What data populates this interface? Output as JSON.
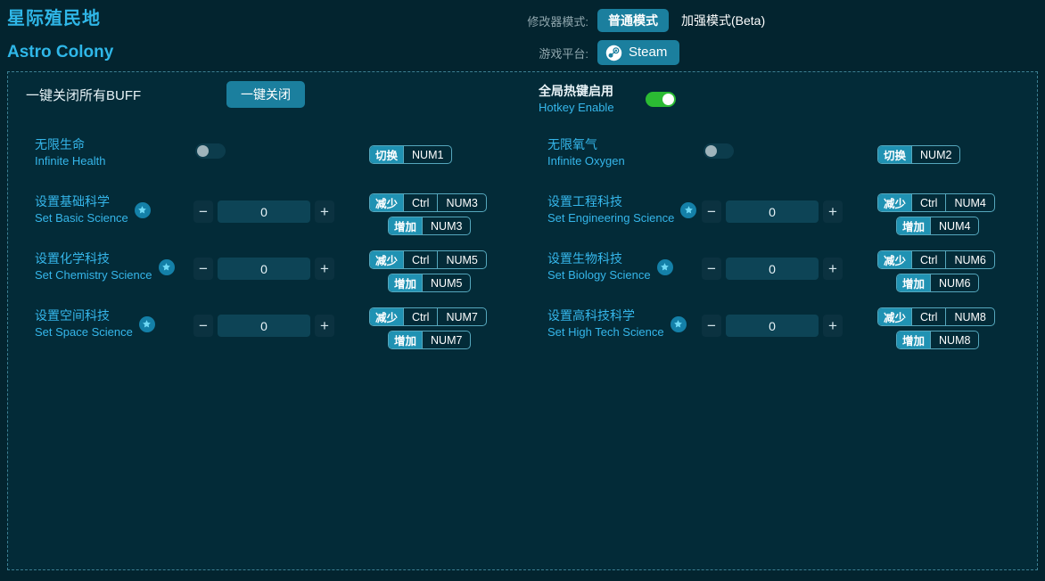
{
  "app": {
    "title_cn": "星际殖民地",
    "title_en": "Astro Colony"
  },
  "header": {
    "mode_label": "修改器模式:",
    "mode_normal": "普通模式",
    "mode_beta": "加强模式(Beta)",
    "platform_label": "游戏平台:",
    "platform_value": "Steam",
    "platform_icon": "steam-icon"
  },
  "toolbar": {
    "close_all_label": "一键关闭所有BUFF",
    "close_all_button": "一键关闭",
    "hotkey_cn": "全局热键启用",
    "hotkey_en": "Hotkey Enable",
    "hotkey_state": "on"
  },
  "left_rows": [
    {
      "cn": "无限生命",
      "en": "Infinite Health",
      "type": "toggle",
      "state": "off",
      "star": false,
      "hotkeys": [
        {
          "tag": "切换",
          "keys": [
            "NUM1"
          ],
          "indent": false
        }
      ]
    },
    {
      "cn": "设置基础科学",
      "en": "Set Basic Science",
      "type": "stepper",
      "value": "0",
      "minus": "−",
      "plus": "+",
      "star": true,
      "hotkeys": [
        {
          "tag": "减少",
          "keys": [
            "Ctrl",
            "NUM3"
          ],
          "indent": false
        },
        {
          "tag": "增加",
          "keys": [
            "NUM3"
          ],
          "indent": true
        }
      ]
    },
    {
      "cn": "设置化学科技",
      "en": "Set Chemistry Science",
      "type": "stepper",
      "value": "0",
      "minus": "−",
      "plus": "+",
      "star": true,
      "hotkeys": [
        {
          "tag": "减少",
          "keys": [
            "Ctrl",
            "NUM5"
          ],
          "indent": false
        },
        {
          "tag": "增加",
          "keys": [
            "NUM5"
          ],
          "indent": true
        }
      ]
    },
    {
      "cn": "设置空间科技",
      "en": "Set Space Science",
      "type": "stepper",
      "value": "0",
      "minus": "−",
      "plus": "+",
      "star": true,
      "hotkeys": [
        {
          "tag": "减少",
          "keys": [
            "Ctrl",
            "NUM7"
          ],
          "indent": false
        },
        {
          "tag": "增加",
          "keys": [
            "NUM7"
          ],
          "indent": true
        }
      ]
    }
  ],
  "right_rows": [
    {
      "cn": "无限氧气",
      "en": "Infinite Oxygen",
      "type": "toggle",
      "state": "off",
      "star": false,
      "hotkeys": [
        {
          "tag": "切换",
          "keys": [
            "NUM2"
          ],
          "indent": false
        }
      ]
    },
    {
      "cn": "设置工程科技",
      "en": "Set Engineering Science",
      "type": "stepper",
      "value": "0",
      "minus": "−",
      "plus": "+",
      "star": true,
      "hotkeys": [
        {
          "tag": "减少",
          "keys": [
            "Ctrl",
            "NUM4"
          ],
          "indent": false
        },
        {
          "tag": "增加",
          "keys": [
            "NUM4"
          ],
          "indent": true
        }
      ]
    },
    {
      "cn": "设置生物科技",
      "en": "Set Biology Science",
      "type": "stepper",
      "value": "0",
      "minus": "−",
      "plus": "+",
      "star": true,
      "hotkeys": [
        {
          "tag": "减少",
          "keys": [
            "Ctrl",
            "NUM6"
          ],
          "indent": false
        },
        {
          "tag": "增加",
          "keys": [
            "NUM6"
          ],
          "indent": true
        }
      ]
    },
    {
      "cn": "设置高科技科学",
      "en": "Set High Tech Science",
      "type": "stepper",
      "value": "0",
      "minus": "−",
      "plus": "+",
      "star": true,
      "hotkeys": [
        {
          "tag": "减少",
          "keys": [
            "Ctrl",
            "NUM8"
          ],
          "indent": false
        },
        {
          "tag": "增加",
          "keys": [
            "NUM8"
          ],
          "indent": true
        }
      ]
    }
  ],
  "colors": {
    "background": "#03242f",
    "panel": "#032b38",
    "accent": "#2fb7e8",
    "button": "#1b7f9e",
    "toggle_on": "#2bbb33",
    "border_dash": "#3c7f92"
  }
}
